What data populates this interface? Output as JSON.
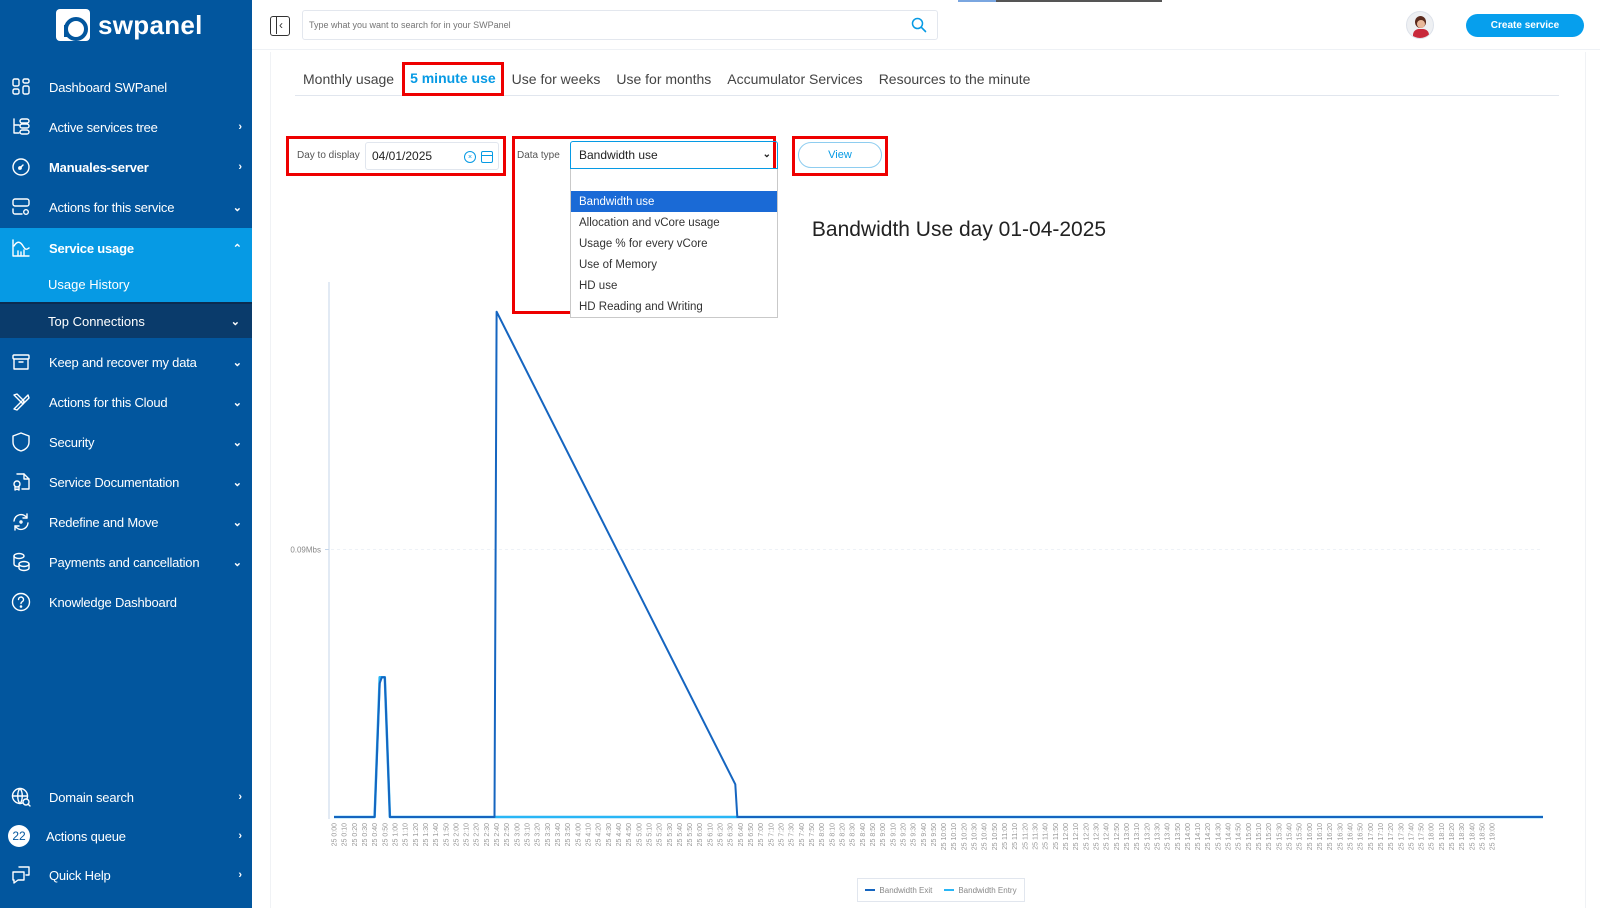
{
  "app": {
    "brand": "swpanel"
  },
  "sidebar": {
    "items": [
      {
        "label": "Dashboard SWPanel",
        "icon": "dashboard-grid-icon",
        "chevron": ""
      },
      {
        "label": "Active services tree",
        "icon": "tree-icon",
        "chevron": "›"
      },
      {
        "label": "Manuales-server",
        "icon": "server-gauge-icon",
        "chevron": "›"
      },
      {
        "label": "Actions for this service",
        "icon": "server-settings-icon",
        "chevron": "⌄"
      },
      {
        "label": "Service usage",
        "icon": "chart-icon",
        "chevron": "⌃"
      },
      {
        "label": "Keep and recover my data",
        "icon": "archive-icon",
        "chevron": "⌄"
      },
      {
        "label": "Actions for this Cloud",
        "icon": "tools-icon",
        "chevron": "⌄"
      },
      {
        "label": "Security",
        "icon": "shield-icon",
        "chevron": "⌄"
      },
      {
        "label": "Service Documentation",
        "icon": "document-certificate-icon",
        "chevron": "⌄"
      },
      {
        "label": "Redefine and Move",
        "icon": "refresh-icon",
        "chevron": "⌄"
      },
      {
        "label": "Payments and cancellation",
        "icon": "coins-icon",
        "chevron": "⌄"
      },
      {
        "label": "Knowledge Dashboard",
        "icon": "help-circle-icon",
        "chevron": ""
      }
    ],
    "subitems": [
      {
        "label": "Usage History"
      },
      {
        "label": "Top Connections",
        "chevron": "⌄"
      }
    ],
    "bottom": [
      {
        "label": "Domain search",
        "icon": "globe-search-icon",
        "chevron": "›"
      },
      {
        "label": "Actions queue",
        "badge": "22",
        "chevron": "›"
      },
      {
        "label": "Quick Help",
        "icon": "chat-icon",
        "chevron": "›"
      }
    ]
  },
  "topbar": {
    "search_placeholder": "Type what you want to search for in your SWPanel",
    "create_label": "Create service"
  },
  "tabs": [
    {
      "label": "Monthly usage",
      "active": false
    },
    {
      "label": "5 minute use",
      "active": true
    },
    {
      "label": "Use for weeks",
      "active": false
    },
    {
      "label": "Use for months",
      "active": false
    },
    {
      "label": "Accumulator Services",
      "active": false
    },
    {
      "label": "Resources to the minute",
      "active": false
    }
  ],
  "controls": {
    "day_label": "Day to display",
    "day_value": "04/01/2025",
    "type_label": "Data type",
    "type_value": "Bandwidth use",
    "options": [
      "Bandwidth use",
      "Allocation and vCore usage",
      "Usage % for every vCore",
      "Use of Memory",
      "HD use",
      "HD Reading and Writing"
    ],
    "view_label": "View"
  },
  "colors": {
    "sidebar_bg": "#02569e",
    "accent": "#069ae4",
    "exit_series": "#1565c0",
    "entry_series": "#29b6f6",
    "highlight": "#e00000"
  },
  "chart_data": {
    "type": "line",
    "title": "Bandwidth Use day 01-04-2025",
    "xlabel": "",
    "ylabel": "",
    "y_tick_labels": [
      "0.09Mbs"
    ],
    "y_ticks": [
      0.09
    ],
    "ylim": [
      0,
      0.18
    ],
    "x_start_label": "25 0:00",
    "x_end_label": "25 19:00",
    "x_step_minutes": 10,
    "legend": [
      "Bandwidth Exit",
      "Bandwidth Entry"
    ],
    "legend_position": "bottom-center",
    "series": [
      {
        "name": "Bandwidth Exit",
        "color": "#1565c0",
        "points": [
          {
            "t": "0:40",
            "v": 0
          },
          {
            "t": "0:45",
            "v": 0.045
          },
          {
            "t": "0:47",
            "v": 0.047
          },
          {
            "t": "0:50",
            "v": 0.047
          },
          {
            "t": "0:55",
            "v": 0
          },
          {
            "t": "2:40",
            "v": 0.17
          },
          {
            "t": "6:35",
            "v": 0.011
          }
        ]
      },
      {
        "name": "Bandwidth Entry",
        "color": "#29b6f6",
        "points": [
          {
            "t": "0:40",
            "v": 0
          },
          {
            "t": "0:45",
            "v": 0.047
          },
          {
            "t": "0:50",
            "v": 0.047
          },
          {
            "t": "0:55",
            "v": 0
          }
        ]
      }
    ]
  }
}
